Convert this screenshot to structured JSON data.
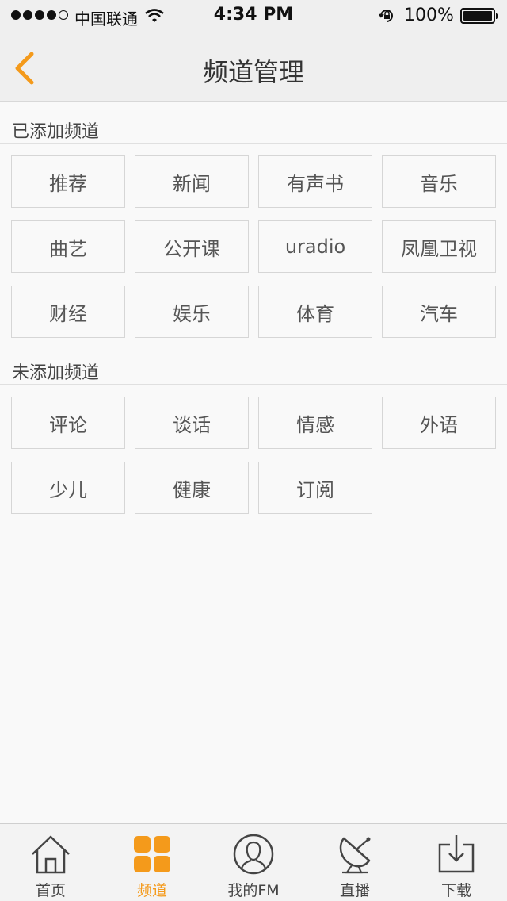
{
  "status_bar": {
    "carrier": "中国联通",
    "time": "4:34 PM",
    "battery": "100%"
  },
  "header": {
    "title": "频道管理",
    "back_icon": "chevron-left-icon"
  },
  "added_section": {
    "label": "已添加频道",
    "channels": [
      "推荐",
      "新闻",
      "有声书",
      "音乐",
      "曲艺",
      "公开课",
      "uradio",
      "凤凰卫视",
      "财经",
      "娱乐",
      "体育",
      "汽车"
    ]
  },
  "unadded_section": {
    "label": "未添加频道",
    "channels": [
      "评论",
      "谈话",
      "情感",
      "外语",
      "少儿",
      "健康",
      "订阅"
    ]
  },
  "tabbar": {
    "tabs": [
      {
        "label": "首页",
        "icon": "home-icon",
        "active": false
      },
      {
        "label": "频道",
        "icon": "channels-grid-icon",
        "active": true
      },
      {
        "label": "我的FM",
        "icon": "user-profile-icon",
        "active": false
      },
      {
        "label": "直播",
        "icon": "satellite-dish-icon",
        "active": false
      },
      {
        "label": "下载",
        "icon": "download-icon",
        "active": false
      }
    ]
  },
  "colors": {
    "accent": "#f49a1b",
    "background": "#f9f9f9",
    "bar": "#efefef"
  }
}
